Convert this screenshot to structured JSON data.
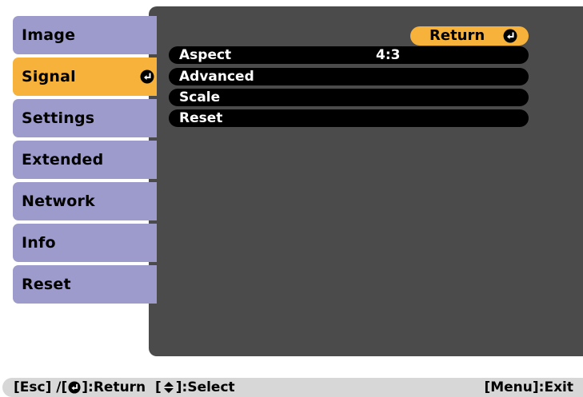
{
  "sidebar": {
    "items": [
      {
        "label": "Image"
      },
      {
        "label": "Signal"
      },
      {
        "label": "Settings"
      },
      {
        "label": "Extended"
      },
      {
        "label": "Network"
      },
      {
        "label": "Info"
      },
      {
        "label": "Reset"
      }
    ],
    "selected_index": 1
  },
  "submenu": {
    "return_label": "Return",
    "items": [
      {
        "label": "Aspect",
        "value": "4:3"
      },
      {
        "label": "Advanced",
        "value": ""
      },
      {
        "label": "Scale",
        "value": ""
      },
      {
        "label": "Reset",
        "value": ""
      }
    ]
  },
  "help": {
    "esc_part1": "[Esc] /[",
    "esc_part2": "]:Return  [",
    "esc_part3": "]:Select",
    "menu_exit": "[Menu]:Exit"
  },
  "colors": {
    "panel": "#4b4b4b",
    "sidebar_item": "#9d9bcc",
    "selected": "#f7b23b",
    "row": "#000000",
    "help_bar": "#d7d7d7"
  },
  "icons": {
    "enter": "enter-icon",
    "updown": "up-down-arrow-icon"
  }
}
